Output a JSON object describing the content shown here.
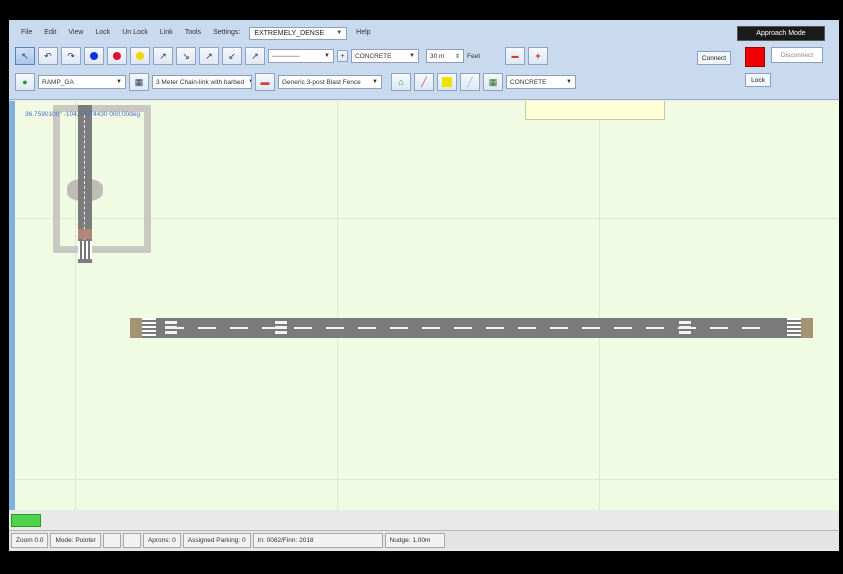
{
  "menubar": {
    "items": [
      "File",
      "Edit",
      "View",
      "Lock",
      "Un Lock",
      "Link",
      "Tools",
      "Settings:"
    ],
    "mode_value": "EXTREMELY_DENSE",
    "help": "Help"
  },
  "approach_mode_label": "Approach Mode",
  "toolbar_row2": {
    "surface_select": "CONCRETE",
    "width_value": "30 m",
    "units_label": "Feet"
  },
  "toolbar_row3": {
    "ramp_select": "RAMP_GA",
    "vehicle_select": "3 Meter Chain-link with barbed",
    "force_select": "Generic 3-post Blast Fence",
    "surface_select2": "CONCRETE"
  },
  "connection": {
    "connect_label": "Connect",
    "disconnect_label": "Disconnect",
    "lock_label": "Lock",
    "status_color": "#f00000"
  },
  "canvas": {
    "coord_text": "36.7590100° -104.77074430 000.00deg"
  },
  "statusbar": {
    "zoom": "Zoom 0.0",
    "mode": "Mode: Pointer",
    "blank": "",
    "aprons": "Aprons: 0",
    "parking": "Assigned Parking: 0",
    "position": "In: 0082/Finn: 2018",
    "nudge": "Nudge: 1.00m"
  }
}
